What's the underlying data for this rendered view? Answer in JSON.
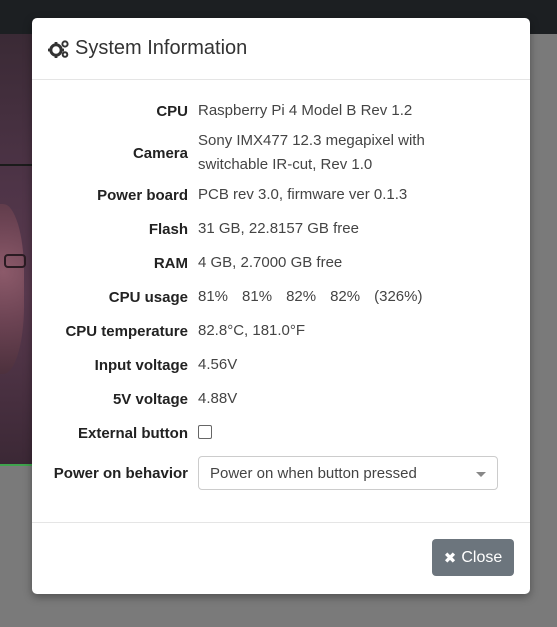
{
  "modal": {
    "title": "System Information",
    "title_icon": "gears-icon"
  },
  "rows": {
    "cpu": {
      "label": "CPU",
      "value": "Raspberry Pi 4 Model B Rev 1.2"
    },
    "camera": {
      "label": "Camera",
      "value": "Sony IMX477 12.3 megapixel with switchable IR-cut, Rev 1.0"
    },
    "power_board": {
      "label": "Power board",
      "value": "PCB rev 3.0, firmware ver 0.1.3"
    },
    "flash": {
      "label": "Flash",
      "value": "31 GB, 22.8157 GB free"
    },
    "ram": {
      "label": "RAM",
      "value": "4 GB, 2.7000 GB free"
    },
    "cpu_usage": {
      "label": "CPU usage",
      "cores": [
        "81%",
        "81%",
        "82%",
        "82%"
      ],
      "total": "(326%)"
    },
    "cpu_temperature": {
      "label": "CPU temperature",
      "value": "82.8°C, 181.0°F"
    },
    "input_voltage": {
      "label": "Input voltage",
      "value": "4.56V"
    },
    "five_v_voltage": {
      "label": "5V voltage",
      "value": "4.88V"
    },
    "external_button": {
      "label": "External button",
      "checked": false
    },
    "power_on_behavior": {
      "label": "Power on behavior",
      "selected": "Power on when button pressed"
    }
  },
  "footer": {
    "close_label": "Close",
    "close_icon": "close-icon"
  },
  "colors": {
    "close_button_bg": "#6c757d",
    "top_bar": "#1c1f22",
    "backdrop": "#7a7a7a"
  }
}
